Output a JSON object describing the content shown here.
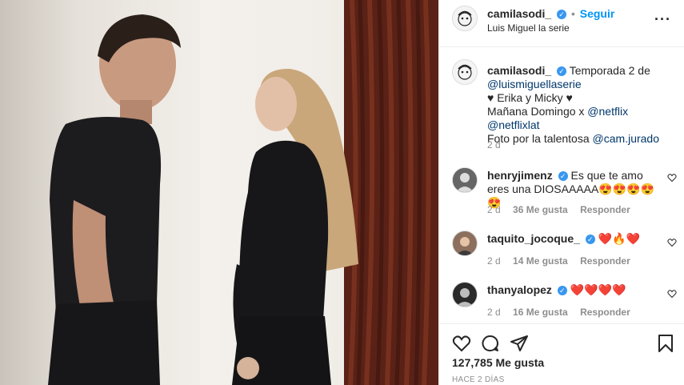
{
  "post": {
    "username": "camilasodi_",
    "follow_label": "Seguir",
    "location": "Luis Miguel la serie",
    "options_icon": "more-horizontal-icon"
  },
  "caption": {
    "username": "camilasodi_",
    "line1": "Temporada 2 de",
    "mention1": "@luismiguellaserie",
    "line2": "♥ Erika y Micky ♥",
    "line3_text": "Mañana Domingo x",
    "mention2": "@netflix",
    "mention3": "@netflixlat",
    "line4_text": "Foto por la talentosa",
    "mention4": "@cam.jurado",
    "age": "2 d"
  },
  "comments": [
    {
      "username": "henryjimenz",
      "verified": true,
      "text": "Es que te amo eres una DIOSAAAAA😍😍😍😍😍",
      "age": "2 d",
      "likes": "36 Me gusta",
      "reply": "Responder"
    },
    {
      "username": "taquito_jocoque_",
      "verified": true,
      "text": "❤️🔥❤️",
      "age": "2 d",
      "likes": "14 Me gusta",
      "reply": "Responder"
    },
    {
      "username": "thanyalopez",
      "verified": true,
      "text": "❤️❤️❤️❤️",
      "age": "2 d",
      "likes": "16 Me gusta",
      "reply": "Responder"
    }
  ],
  "footer": {
    "likes": "127,785 Me gusta",
    "timestamp": "HACE 2 DÍAS"
  },
  "colors": {
    "accent": "#0095f6",
    "verified": "#3897f0",
    "mention": "#00376b"
  }
}
